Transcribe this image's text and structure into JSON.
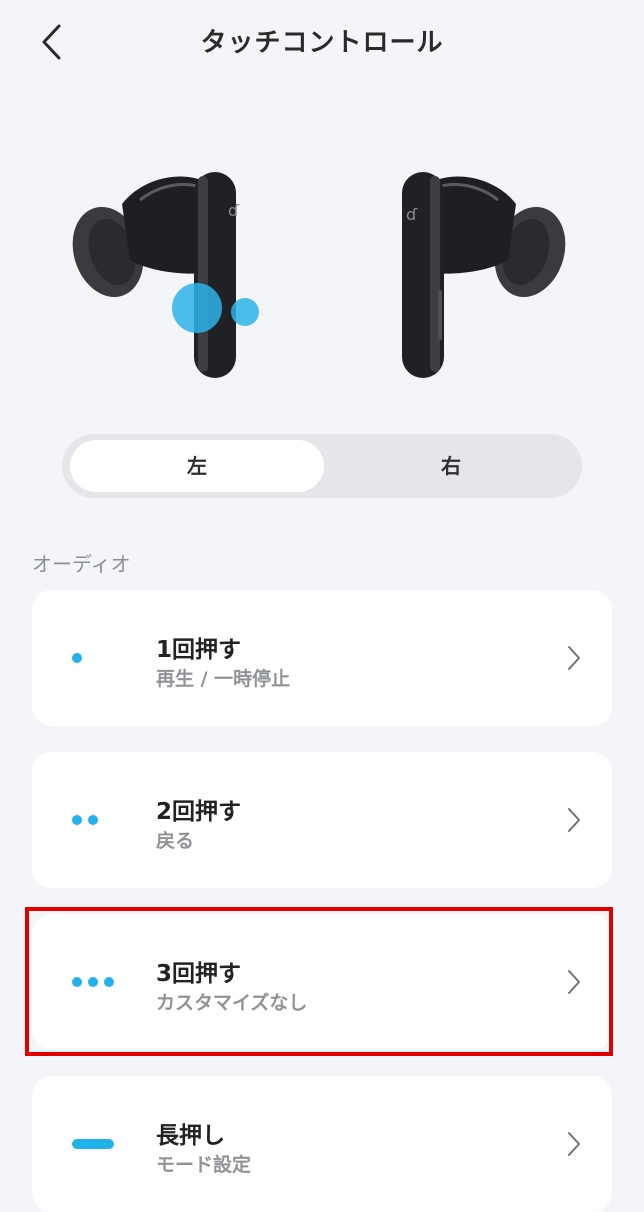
{
  "header": {
    "title": "タッチコントロール",
    "back_icon": "chevron-left-icon"
  },
  "segment": {
    "left_label": "左",
    "right_label": "右",
    "selected": "左"
  },
  "section": {
    "label": "オーディオ"
  },
  "cards": [
    {
      "title": "1回押す",
      "subtitle": "再生 / 一時停止",
      "indicator": "single-dot-icon"
    },
    {
      "title": "2回押す",
      "subtitle": "戻る",
      "indicator": "double-dot-icon"
    },
    {
      "title": "3回押す",
      "subtitle": "カスタマイズなし",
      "indicator": "triple-dot-icon"
    },
    {
      "title": "長押し",
      "subtitle": "モード設定",
      "indicator": "long-press-bar-icon"
    }
  ],
  "colors": {
    "accent": "#20b2e8",
    "highlight_border": "#e00000",
    "background": "#f3f5f8"
  }
}
